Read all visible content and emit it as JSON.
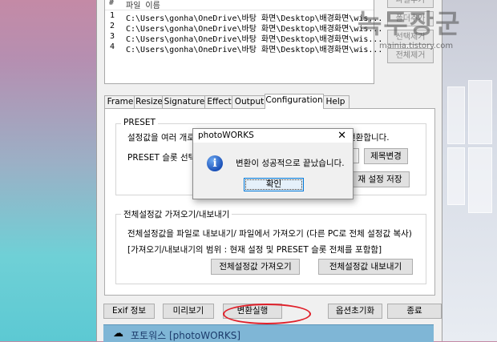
{
  "file_list": {
    "columns": [
      "#",
      "파일 이름"
    ],
    "rows": [
      {
        "num": "1",
        "path": "C:\\Users\\gonha\\OneDrive\\바탕 화면\\Desktop\\배경화면\\wis..."
      },
      {
        "num": "2",
        "path": "C:\\Users\\gonha\\OneDrive\\바탕 화면\\Desktop\\배경화면\\wis..."
      },
      {
        "num": "3",
        "path": "C:\\Users\\gonha\\OneDrive\\바탕 화면\\Desktop\\배경화면\\wis..."
      },
      {
        "num": "4",
        "path": "C:\\Users\\gonha\\OneDrive\\바탕 화면\\Desktop\\배경화면\\wis..."
      }
    ]
  },
  "side_buttons": [
    "파일추가",
    "폴더추가",
    "선택제거",
    "전체제거"
  ],
  "tabs": [
    "Frame",
    "Resize",
    "Signature",
    "Effect",
    "Output",
    "Configuration",
    "Help"
  ],
  "active_tab": "Configuration",
  "preset": {
    "title": "PRESET",
    "desc_left": "설정값을 여러 개로",
    "desc_right": "전환합니다.",
    "select_label": "PRESET 슬롯 선택",
    "rename_button": "제목변경",
    "save_button": "재 설정 저장"
  },
  "import_export": {
    "title": "전체설정값 가져오기/내보내기",
    "desc1": "전체설정값을 파일로 내보내기/ 파일에서 가져오기 (다른 PC로 전체 설정값 복사)",
    "desc2": "[가져오기/내보내기의 범위 : 현재 설정 및 PRESET 슬롯 전체를 포함함]",
    "import_button": "전체설정값 가져오기",
    "export_button": "전체설정값 내보내기"
  },
  "bottom_buttons": {
    "exif": "Exif 정보",
    "preview": "미리보기",
    "convert": "변환실행",
    "reset": "옵션초기화",
    "exit": "종료"
  },
  "banner_text": "포토워스 [photoWORKS]",
  "dialog": {
    "title": "photoWORKS",
    "close": "✕",
    "icon": "info-icon",
    "message": "변환이 성공적으로 끝났습니다.",
    "ok_button": "확인"
  },
  "watermark": {
    "text": "녹두장군",
    "url": "mainia.tistory.com"
  },
  "colors": {
    "highlight": "#e0202a",
    "dialog_focus": "#0078d7"
  }
}
